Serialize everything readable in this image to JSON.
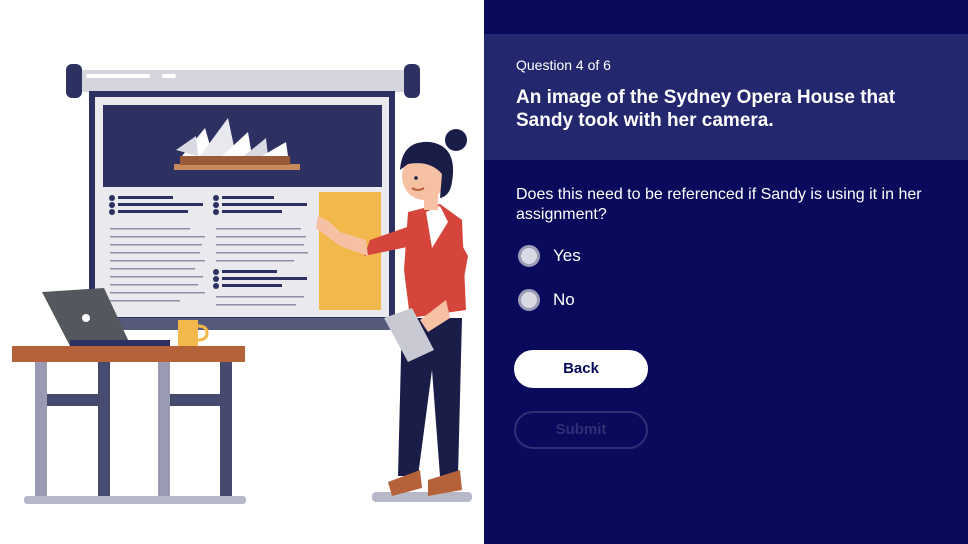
{
  "quiz": {
    "counter": "Question 4 of 6",
    "title": "An image of the Sydney Opera House that Sandy took with her camera.",
    "prompt": "Does this need to be referenced if Sandy is using it in her assignment?",
    "options": [
      {
        "label": "Yes",
        "selected": false
      },
      {
        "label": "No",
        "selected": false
      }
    ],
    "back_label": "Back",
    "submit_label": "Submit",
    "submit_enabled": false
  },
  "colors": {
    "panel_bg": "#0a0a5c",
    "header_bg": "#23276e",
    "accent_yellow": "#f2b84b",
    "jumper_red": "#d6453b",
    "desk_brown": "#b5613a"
  }
}
